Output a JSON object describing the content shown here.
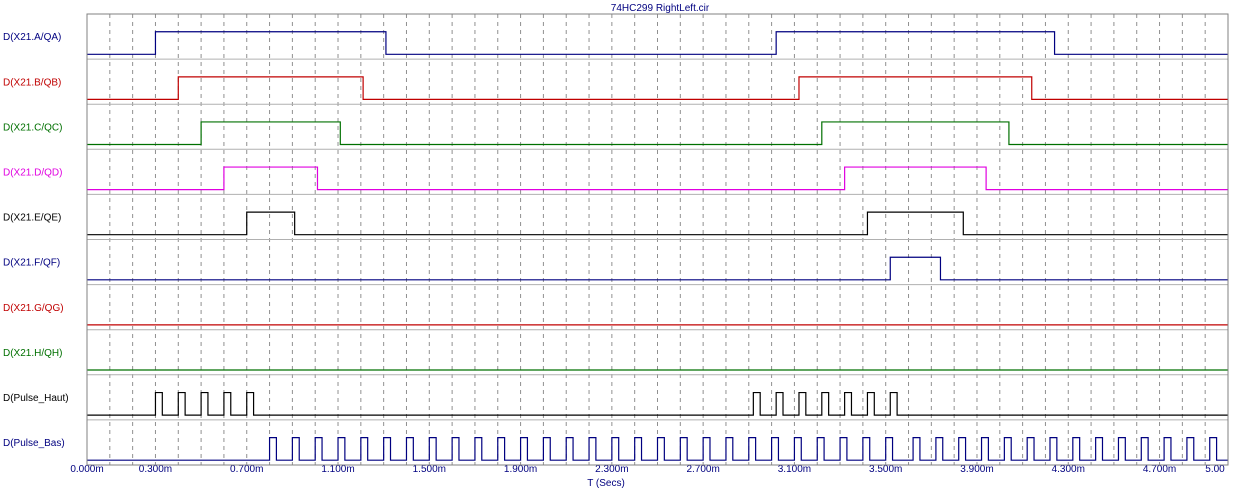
{
  "chart_data": {
    "type": "line",
    "title": "74HC299 RightLeft.cir",
    "xlabel": "T (Secs)",
    "xlim": [
      0,
      5.0
    ],
    "xunit": "ms",
    "grid": true,
    "tick_values": [
      0,
      0.1,
      0.2,
      0.3,
      0.4,
      0.5,
      0.6,
      0.7,
      0.8,
      0.9,
      1.0,
      1.1,
      1.2,
      1.3,
      1.4,
      1.5,
      1.6,
      1.7,
      1.8,
      1.9,
      2.0,
      2.1,
      2.2,
      2.3,
      2.4,
      2.5,
      2.6,
      2.7,
      2.8,
      2.9,
      3.0,
      3.1,
      3.2,
      3.3,
      3.4,
      3.5,
      3.6,
      3.7,
      3.8,
      3.9,
      4.0,
      4.1,
      4.2,
      4.3,
      4.4,
      4.5,
      4.6,
      4.7,
      4.8,
      4.9,
      5.0
    ],
    "tick_labels": [
      {
        "x": 0,
        "text": "0.000m"
      },
      {
        "x": 0.3,
        "text": "0.300m"
      },
      {
        "x": 0.7,
        "text": "0.700m"
      },
      {
        "x": 1.1,
        "text": "1.100m"
      },
      {
        "x": 1.5,
        "text": "1.500m"
      },
      {
        "x": 1.9,
        "text": "1.900m"
      },
      {
        "x": 2.3,
        "text": "2.300m"
      },
      {
        "x": 2.7,
        "text": "2.700m"
      },
      {
        "x": 3.1,
        "text": "3.100m"
      },
      {
        "x": 3.5,
        "text": "3.500m"
      },
      {
        "x": 3.9,
        "text": "3.900m"
      },
      {
        "x": 4.3,
        "text": "4.300m"
      },
      {
        "x": 4.7,
        "text": "4.700m"
      },
      {
        "x": 5.0,
        "text": "5.00"
      }
    ],
    "series": [
      {
        "name": "D(X21.A/QA)",
        "color": "#000080",
        "high": [
          [
            0.3,
            1.31
          ],
          [
            3.02,
            4.24
          ]
        ]
      },
      {
        "name": "D(X21.B/QB)",
        "color": "#C00000",
        "high": [
          [
            0.4,
            1.21
          ],
          [
            3.12,
            4.14
          ]
        ]
      },
      {
        "name": "D(X21.C/QC)",
        "color": "#007000",
        "high": [
          [
            0.5,
            1.11
          ],
          [
            3.22,
            4.04
          ]
        ]
      },
      {
        "name": "D(X21.D/QD)",
        "color": "#E000E0",
        "high": [
          [
            0.6,
            1.01
          ],
          [
            3.32,
            3.94
          ]
        ]
      },
      {
        "name": "D(X21.E/QE)",
        "color": "#000000",
        "high": [
          [
            0.7,
            0.91
          ],
          [
            3.42,
            3.84
          ]
        ]
      },
      {
        "name": "D(X21.F/QF)",
        "color": "#000080",
        "high": [
          [
            3.52,
            3.74
          ]
        ]
      },
      {
        "name": "D(X21.G/QG)",
        "color": "#C00000",
        "high": []
      },
      {
        "name": "D(X21.H/QH)",
        "color": "#007000",
        "high": []
      },
      {
        "name": "D(Pulse_Haut)",
        "color": "#000000",
        "pulses": [
          {
            "start": 0.3,
            "period": 0.1,
            "width": 0.03,
            "count": 5
          },
          {
            "start": 2.92,
            "period": 0.1,
            "width": 0.03,
            "count": 7
          }
        ]
      },
      {
        "name": "D(Pulse_Bas)",
        "color": "#000080",
        "pulses": [
          {
            "start": 0.8,
            "period": 0.1,
            "width": 0.03,
            "count": 28
          },
          {
            "start": 3.62,
            "period": 0.1,
            "width": 0.03,
            "count": 14
          }
        ]
      }
    ]
  }
}
